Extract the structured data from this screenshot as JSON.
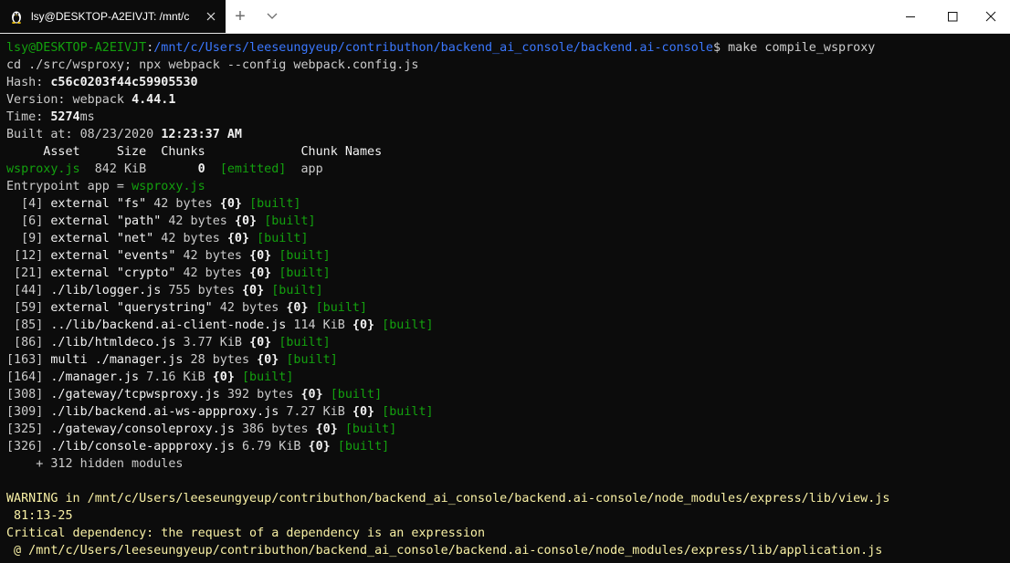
{
  "window": {
    "tab_title": "lsy@DESKTOP-A2EIVJT: /mnt/c",
    "tab_icon": "linux-tux-icon",
    "new_tab_label": "+",
    "controls": [
      "minimize-icon",
      "maximize-icon",
      "close-icon"
    ]
  },
  "colors": {
    "terminal_bg": "#0c0c0c",
    "prompt_green": "#13a10e",
    "path_blue": "#3b78ff",
    "warning_yellow": "#f9f1a5",
    "default_text": "#cccccc"
  },
  "prompt": {
    "user_host": "lsy@DESKTOP-A2EIVJT",
    "path": "/mnt/c/Users/leeseungyeup/contributhon/backend_ai_console/backend.ai-console",
    "symbol": "$",
    "command": "make compile_wsproxy"
  },
  "output": {
    "cmd_line": "cd ./src/wsproxy; npx webpack --config webpack.config.js",
    "hash_label": "Hash: ",
    "hash": "c56c0203f44c59905530",
    "version_label": "Version: webpack ",
    "version": "4.44.1",
    "time_label": "Time: ",
    "time_value": "5274",
    "time_unit": "ms",
    "built_label": "Built at: 08/23/2020 ",
    "built_time": "12:23:37 AM",
    "asset_header": "     Asset     Size  Chunks             Chunk Names",
    "asset": {
      "name": "wsproxy.js",
      "size": "  842 KiB  ",
      "chunk": "     0",
      "status": "[emitted]",
      "chunk_name": "app"
    },
    "entrypoint_label": "Entrypoint app = ",
    "entrypoint_file": "wsproxy.js",
    "modules": [
      {
        "id": "  [4] ",
        "name": "external \"fs\"",
        "size": " 42 bytes ",
        "chunk": "{0}",
        "status": "[built]"
      },
      {
        "id": "  [6] ",
        "name": "external \"path\"",
        "size": " 42 bytes ",
        "chunk": "{0}",
        "status": "[built]"
      },
      {
        "id": "  [9] ",
        "name": "external \"net\"",
        "size": " 42 bytes ",
        "chunk": "{0}",
        "status": "[built]"
      },
      {
        "id": " [12] ",
        "name": "external \"events\"",
        "size": " 42 bytes ",
        "chunk": "{0}",
        "status": "[built]"
      },
      {
        "id": " [21] ",
        "name": "external \"crypto\"",
        "size": " 42 bytes ",
        "chunk": "{0}",
        "status": "[built]"
      },
      {
        "id": " [44] ",
        "name": "./lib/logger.js",
        "size": " 755 bytes ",
        "chunk": "{0}",
        "status": "[built]"
      },
      {
        "id": " [59] ",
        "name": "external \"querystring\"",
        "size": " 42 bytes ",
        "chunk": "{0}",
        "status": "[built]"
      },
      {
        "id": " [85] ",
        "name": "../lib/backend.ai-client-node.js",
        "size": " 114 KiB ",
        "chunk": "{0}",
        "status": "[built]"
      },
      {
        "id": " [86] ",
        "name": "./lib/htmldeco.js",
        "size": " 3.77 KiB ",
        "chunk": "{0}",
        "status": "[built]"
      },
      {
        "id": "[163] ",
        "name": "multi ./manager.js",
        "size": " 28 bytes ",
        "chunk": "{0}",
        "status": "[built]"
      },
      {
        "id": "[164] ",
        "name": "./manager.js",
        "size": " 7.16 KiB ",
        "chunk": "{0}",
        "status": "[built]"
      },
      {
        "id": "[308] ",
        "name": "./gateway/tcpwsproxy.js",
        "size": " 392 bytes ",
        "chunk": "{0}",
        "status": "[built]"
      },
      {
        "id": "[309] ",
        "name": "./lib/backend.ai-ws-appproxy.js",
        "size": " 7.27 KiB ",
        "chunk": "{0}",
        "status": "[built]"
      },
      {
        "id": "[325] ",
        "name": "./gateway/consoleproxy.js",
        "size": " 386 bytes ",
        "chunk": "{0}",
        "status": "[built]"
      },
      {
        "id": "[326] ",
        "name": "./lib/console-appproxy.js",
        "size": " 6.79 KiB ",
        "chunk": "{0}",
        "status": "[built]"
      }
    ],
    "hidden_modules": "    + 312 hidden modules",
    "warning_line": "WARNING in /mnt/c/Users/leeseungyeup/contributhon/backend_ai_console/backend.ai-console/node_modules/express/lib/view.js",
    "warning_loc": " 81:13-25",
    "warning_msg": "Critical dependency: the request of a dependency is an expression",
    "warning_at": " @ /mnt/c/Users/leeseungyeup/contributhon/backend_ai_console/backend.ai-console/node_modules/express/lib/application.js"
  }
}
